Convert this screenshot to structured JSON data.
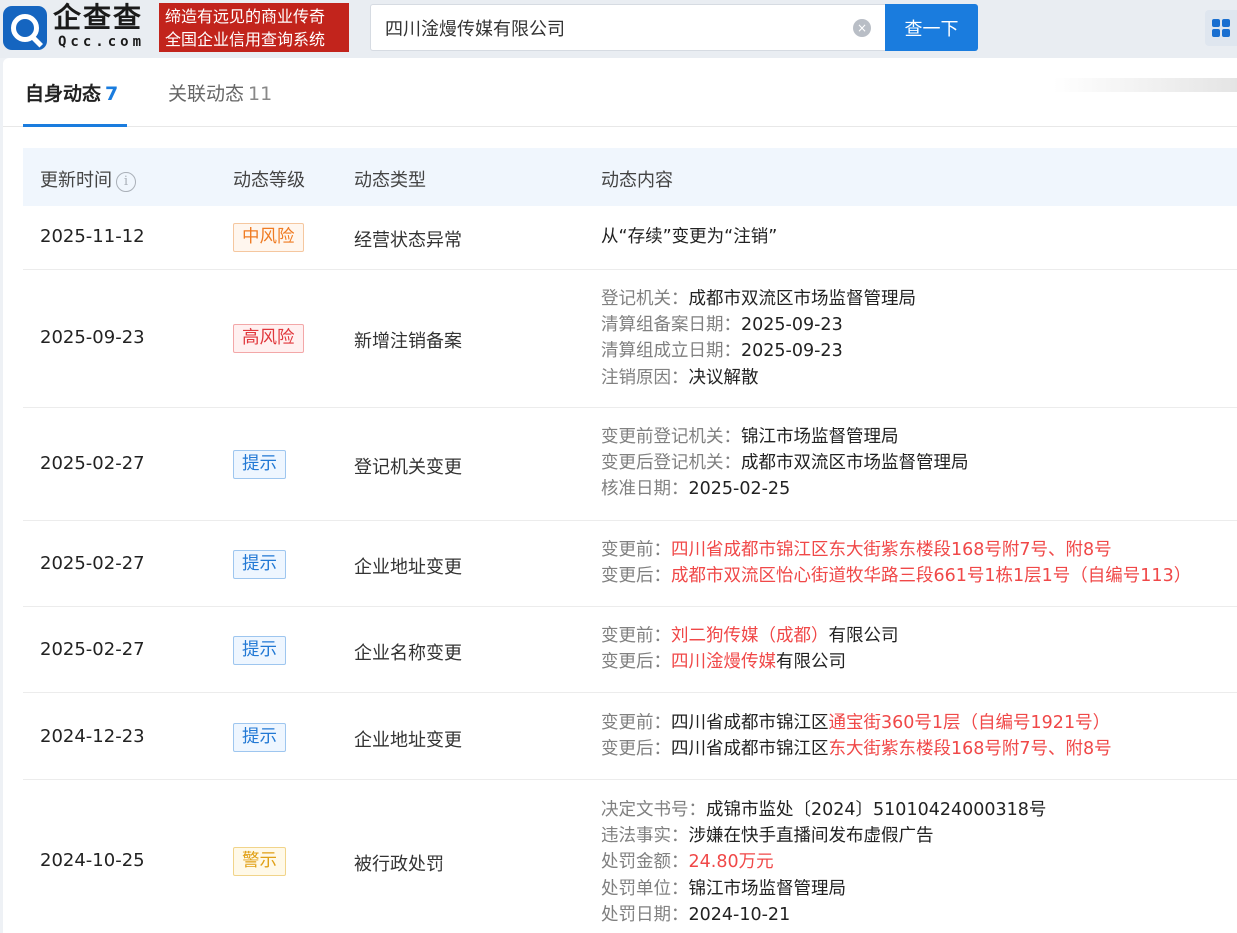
{
  "header": {
    "logo_text": "企查查",
    "logo_sub": "Qcc.com",
    "slogan_line1": "缔造有远见的商业传奇",
    "slogan_line2": "全国企业信用查询系统",
    "search_value": "四川淦熳传媒有限公司",
    "clear_icon": "×",
    "search_button": "查一下",
    "apps_icon": "grid-icon"
  },
  "tabs": {
    "own_label": "自身动态",
    "own_count": "7",
    "rel_label": "关联动态",
    "rel_count": "11"
  },
  "table": {
    "columns": [
      "更新时间",
      "动态等级",
      "动态类型",
      "动态内容"
    ],
    "info_icon": "i",
    "rows": [
      {
        "date": "2025-11-12",
        "level": "中风险",
        "type": "经营状态异常",
        "content": {
          "l0": "从“存续”变更为“注销”"
        }
      },
      {
        "date": "2025-09-23",
        "level": "高风险",
        "type": "新增注销备案",
        "content": {
          "l0k": "登记机关：",
          "l0v": "成都市双流区市场监督管理局",
          "l1k": "清算组备案日期：",
          "l1v": "2025-09-23",
          "l2k": "清算组成立日期：",
          "l2v": "2025-09-23",
          "l3k": "注销原因：",
          "l3v": "决议解散"
        }
      },
      {
        "date": "2025-02-27",
        "level": "提示",
        "type": "登记机关变更",
        "content": {
          "l0k": "变更前登记机关：",
          "l0v": "锦江市场监督管理局",
          "l1k": "变更后登记机关：",
          "l1v": "成都市双流区市场监督管理局",
          "l2k": "核准日期：",
          "l2v": "2025-02-25"
        }
      },
      {
        "date": "2025-02-27",
        "level": "提示",
        "type": "企业地址变更",
        "content": {
          "l0k": "变更前：",
          "l0r": "四川省成都市锦江区东大街紫东楼段168号附7号、附8号",
          "l1k": "变更后：",
          "l1r": "成都市双流区怡心街道牧华路三段661号1栋1层1号（自编号113）"
        }
      },
      {
        "date": "2025-02-27",
        "level": "提示",
        "type": "企业名称变更",
        "content": {
          "l0k": "变更前：",
          "l0r": "刘二狗传媒（成都）",
          "l0v": "有限公司",
          "l1k": "变更后：",
          "l1r": "四川淦熳传媒",
          "l1v": "有限公司"
        }
      },
      {
        "date": "2024-12-23",
        "level": "提示",
        "type": "企业地址变更",
        "content": {
          "l0k": "变更前：",
          "l0v": "四川省成都市锦江区",
          "l0r": "通宝街360号1层（自编号1921号）",
          "l1k": "变更后：",
          "l1v": "四川省成都市锦江区",
          "l1r": "东大街紫东楼段168号附7号、附8号"
        }
      },
      {
        "date": "2024-10-25",
        "level": "警示",
        "type": "被行政处罚",
        "content": {
          "l0k": "决定文书号：",
          "l0v": "成锦市监处〔2024〕51010424000318号",
          "l1k": "违法事实：",
          "l1v": "涉嫌在快手直播间发布虚假广告",
          "l2k": "处罚金额：",
          "l2r": "24.80万元",
          "l3k": "处罚单位：",
          "l3v": "锦江市场监督管理局",
          "l4k": "处罚日期：",
          "l4v": "2024-10-21"
        }
      }
    ]
  },
  "colors": {
    "brand_blue": "#1a7cde",
    "slogan_red": "#c2241c",
    "highlight_red": "#f04848",
    "mid_risk": "#ef7b23",
    "high_risk": "#e0363b",
    "tip": "#2178d4",
    "warn": "#e0a016"
  }
}
